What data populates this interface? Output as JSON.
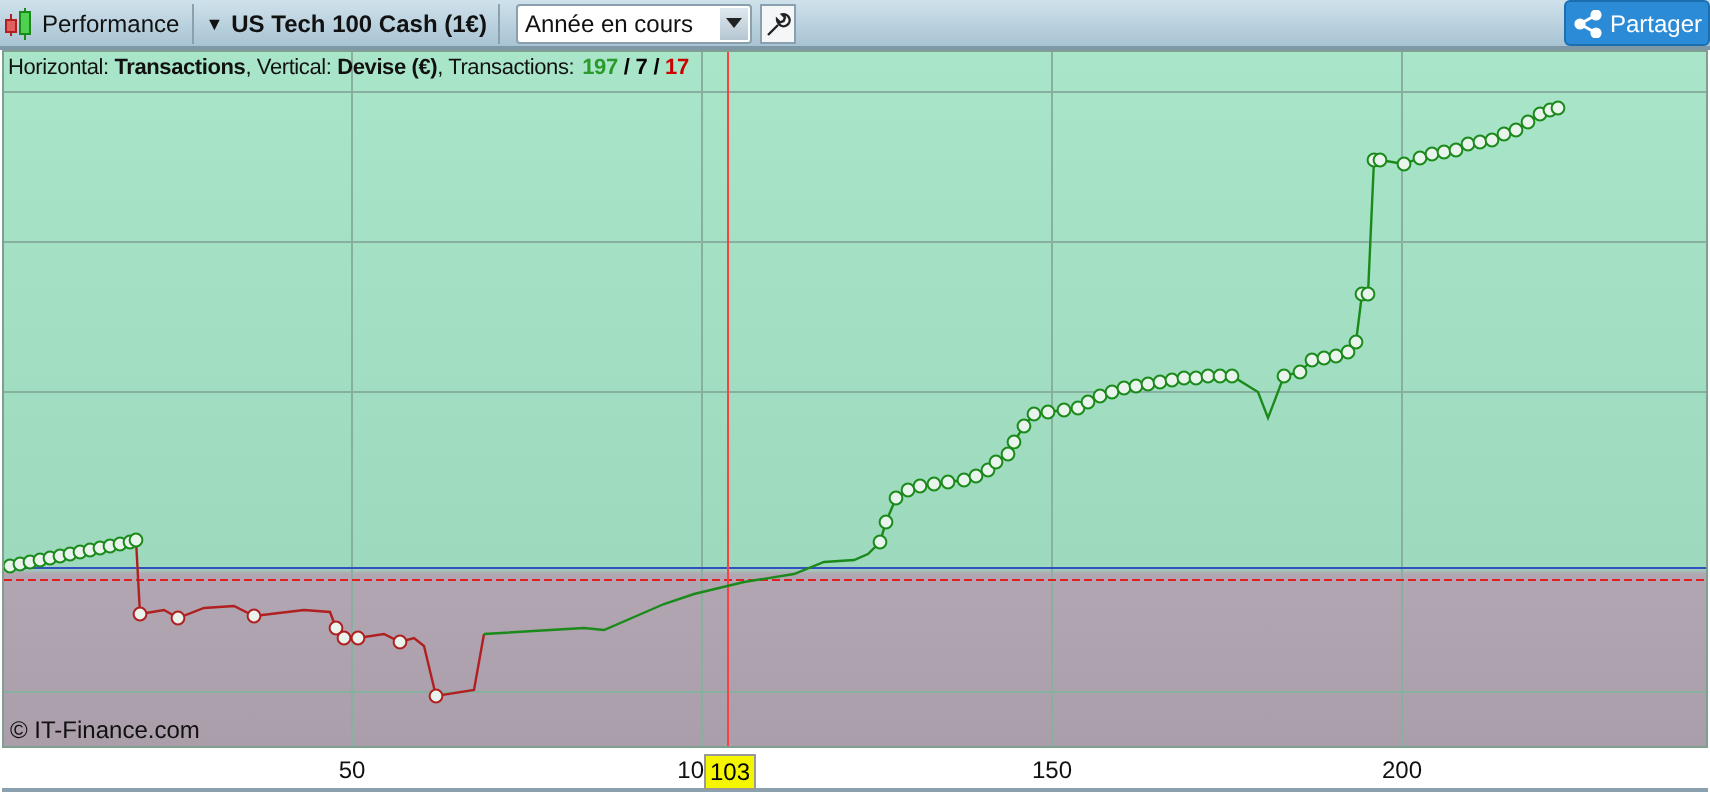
{
  "toolbar": {
    "view_label": "Performance",
    "instrument": {
      "caret": "▼",
      "label": "US Tech 100 Cash (1€)"
    },
    "period": {
      "value": "Année en cours"
    },
    "share_button": "Partager"
  },
  "chart": {
    "legend": {
      "text": "Horizontal: **Transactions**, Vertical: **Devise (€)**, Transactions:",
      "parts": [
        {
          "text": "197",
          "color": "#2a9a2a"
        },
        {
          "text": "/",
          "color": "#000000"
        },
        {
          "text": "7",
          "color": "#000000"
        },
        {
          "text": "/",
          "color": "#000000"
        },
        {
          "text": "17",
          "color": "#cc0000"
        }
      ]
    },
    "copyright": "© IT-Finance.com",
    "x_axis": {
      "ticks": [
        "50",
        "10",
        "150",
        "200"
      ]
    },
    "cursor": {
      "label": "103"
    }
  }
}
